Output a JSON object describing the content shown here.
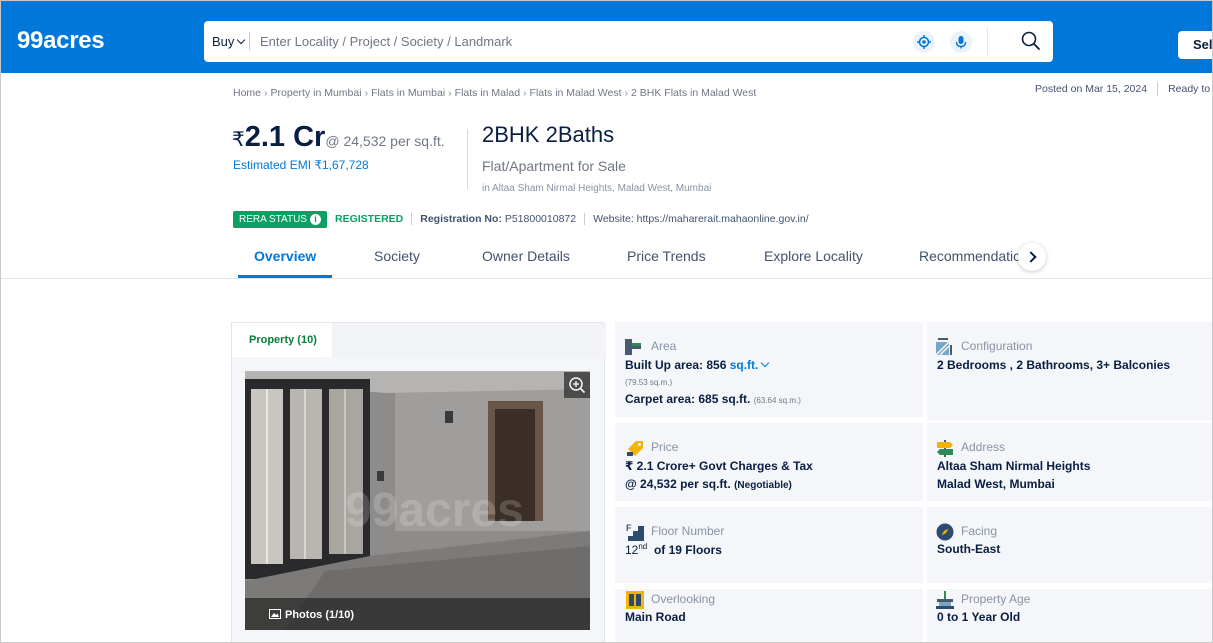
{
  "header": {
    "logo": "99acres",
    "buy_select": "Buy",
    "search_placeholder": "Enter Locality / Project / Society / Landmark",
    "sell_label": "Sel"
  },
  "breadcrumb": [
    "Home",
    "Property in Mumbai",
    "Flats in Mumbai",
    "Flats in Malad",
    "Flats in Malad West",
    "2 BHK Flats in Malad West"
  ],
  "posted": {
    "date": "Posted on Mar 15, 2024",
    "status": "Ready to"
  },
  "price": {
    "currency": "₹",
    "amount": "2.1 Cr",
    "per_sqft": "@ 24,532 per sq.ft.",
    "emi": "Estimated EMI ₹1,67,728"
  },
  "property": {
    "title": "2BHK 2Baths",
    "subtitle": "Flat/Apartment for Sale",
    "location": "in Altaa Sham Nirmal Heights, Malad West, Mumbai"
  },
  "rera": {
    "badge": "RERA STATUS",
    "status": "REGISTERED",
    "reg_label": "Registration No:",
    "reg_no": "P51800010872",
    "website": "Website: https://maharerait.mahaonline.gov.in/"
  },
  "tabs": [
    "Overview",
    "Society",
    "Owner Details",
    "Price Trends",
    "Explore Locality",
    "Recommendatic"
  ],
  "photos": {
    "tab_label": "Property (10)",
    "counter": "Photos (1/10)",
    "watermark": "99acres"
  },
  "details": {
    "area": {
      "label": "Area",
      "built_up": "Built Up area: 856",
      "unit": "sq.ft.",
      "built_up_sqm": "(79.53 sq.m.)",
      "carpet": "Carpet area: 685 sq.ft.",
      "carpet_sqm": "(63.64 sq.m.)"
    },
    "configuration": {
      "label": "Configuration",
      "value": "2 Bedrooms , 2 Bathrooms, 3+ Balconies"
    },
    "price": {
      "label": "Price",
      "value": "₹ 2.1 Crore+ Govt Charges & Tax",
      "per_sqft": "@ 24,532 per sq.ft.",
      "negotiable": "(Negotiable)"
    },
    "address": {
      "label": "Address",
      "line1": "Altaa Sham Nirmal Heights",
      "line2": "Malad West, Mumbai"
    },
    "floor": {
      "label": "Floor Number",
      "floor_num": "12",
      "floor_sup": "nd",
      "floor_rest": "of 19 Floors"
    },
    "facing": {
      "label": "Facing",
      "value": "South-East"
    },
    "overlooking": {
      "label": "Overlooking",
      "value": "Main Road"
    },
    "age": {
      "label": "Property Age",
      "value": "0 to 1 Year Old"
    }
  }
}
